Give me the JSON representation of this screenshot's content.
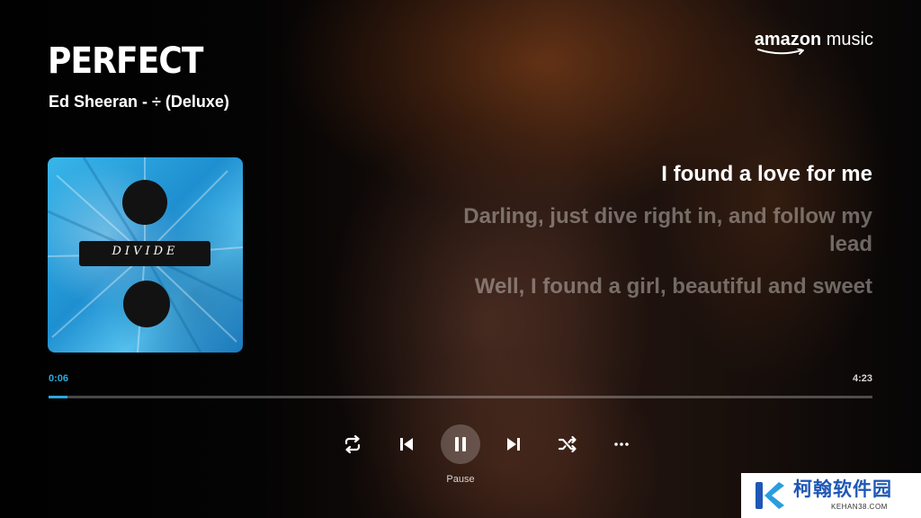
{
  "track": {
    "title": "PERFECT",
    "subtitle": "Ed Sheeran - ÷ (Deluxe)"
  },
  "brand": {
    "name_left": "amazon",
    "name_right": "music"
  },
  "album": {
    "cover_text": "DIVIDE",
    "background_color": "#39b6ea"
  },
  "lyrics": [
    "I found a love for me",
    "Darling, just dive right in, and follow my lead",
    "Well, I found a girl, beautiful and sweet"
  ],
  "playback": {
    "current_time": "0:06",
    "duration": "4:23",
    "progress_fraction": 0.023,
    "accent_color": "#2aa9e0"
  },
  "controls": {
    "repeat_icon": "repeat-icon",
    "previous_icon": "skip-previous-icon",
    "pause_icon": "pause-icon",
    "next_icon": "skip-next-icon",
    "shuffle_icon": "shuffle-icon",
    "more_icon": "more-options-icon",
    "pause_label": "Pause"
  },
  "watermark": {
    "title": "柯翰软件园",
    "subtitle": "KEHAN38.COM"
  }
}
